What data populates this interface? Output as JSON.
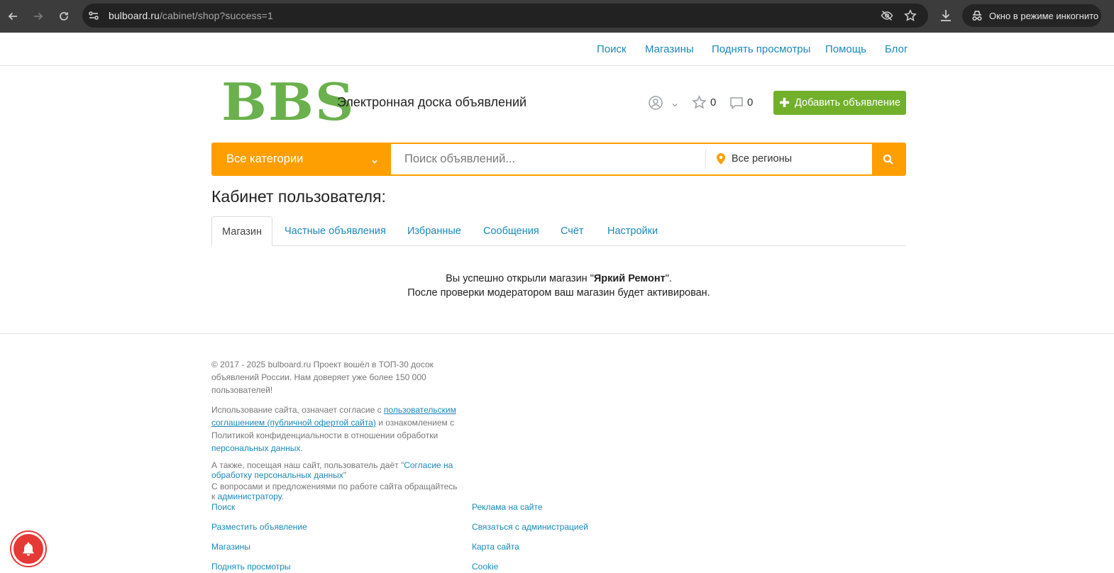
{
  "browser": {
    "url_host": "bulboard.ru",
    "url_path": "/cabinet/shop?success=1",
    "incognito_label": "Окно в режиме инкогнито"
  },
  "toplinks": [
    "Поиск",
    "Магазины",
    "Поднять просмотры",
    "Помощь",
    "Блог"
  ],
  "header": {
    "logo": "BBS",
    "tagline": "Электронная доска объявлений",
    "favorites_count": "0",
    "messages_count": "0",
    "add_button": "Добавить объявление"
  },
  "search": {
    "category": "Все категории",
    "placeholder": "Поиск объявлений...",
    "region": "Все регионы"
  },
  "cabinet": {
    "title": "Кабинет пользователя:",
    "tabs": [
      "Магазин",
      "Частные объявления",
      "Избранные",
      "Сообщения",
      "Счёт",
      "Настройки"
    ],
    "msg_prefix": "Вы успешно открыли магазин \"",
    "shop_name": "Яркий Ремонт",
    "msg_suffix": "\".",
    "msg_line2": "После проверки модератором ваш магазин будет активирован."
  },
  "footer": {
    "copyright": "© 2017 - 2025 bulboard.ru Проект вошёл в ТОП-30 досок объявлений России. Нам доверяет уже более 150 000 пользователей!",
    "p2_a": "Использование сайта, означает согласие с ",
    "p2_link": "пользовательским соглашением (публичной офертой сайта)",
    "p2_b": " и ознакомлением с Политикой конфиденциальности в отношении обработки ",
    "p2_link2": "персональных данных",
    "p2_c": ".",
    "p3_a": "А также, посещая наш сайт, пользователь даёт \"",
    "p3_link": "Согласие на обработку персональных данных",
    "p3_b": "\"",
    "p4_a": "С вопросами  и предложениями по работе сайта обращайтесь к ",
    "p4_link": "администратору",
    "p4_b": ".",
    "links_left": [
      "Поиск",
      "Разместить объявление",
      "Магазины",
      "Поднять просмотры"
    ],
    "links_right": [
      "Реклама на сайте",
      "Связаться с администрацией",
      "Карта сайта",
      "Cookie"
    ]
  },
  "colors": {
    "accent_orange": "#ff9e00",
    "button_green": "#72b02c",
    "logo_green": "#6ab04c",
    "link_blue": "#1a89b8",
    "bell_red": "#e53935"
  }
}
